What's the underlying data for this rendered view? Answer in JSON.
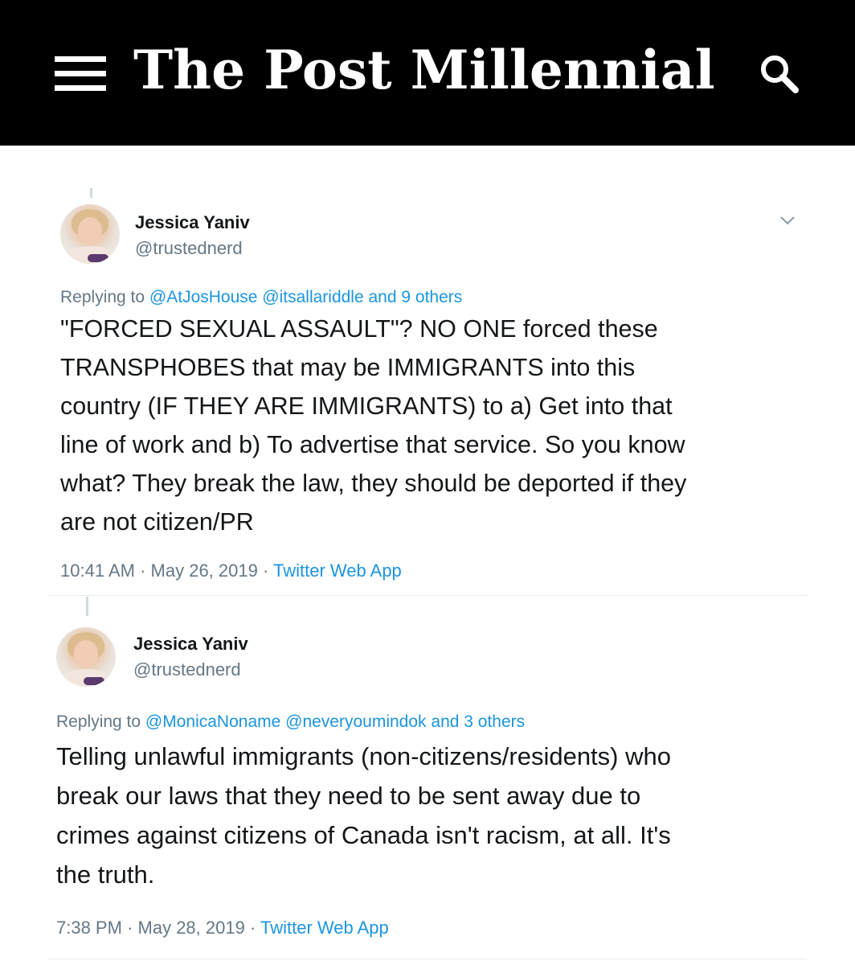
{
  "site": {
    "name": "The Post Millennial",
    "menu_icon": "hamburger-menu-icon",
    "search_icon": "search-icon",
    "header_bg": "#000000"
  },
  "colors": {
    "link": "#1b95e0",
    "muted": "#657786",
    "text": "#14171a"
  },
  "tweets": [
    {
      "author_name": "Jessica Yaniv",
      "handle": "@trustednerd",
      "replying_prefix": "Replying to",
      "replying_mentions": "@AtJosHouse @itsallariddle",
      "replying_and": "and",
      "replying_others": "9 others",
      "text_lines": [
        "\"FORCED SEXUAL ASSAULT\"? NO ONE forced these",
        "TRANSPHOBES that may be IMMIGRANTS into this",
        "country (IF THEY ARE IMMIGRANTS) to a) Get into that",
        "line of work and b) To advertise that service. So you know",
        "what? They break the law, they should be deported if they",
        "are not citizen/PR"
      ],
      "time": "10:41 AM",
      "date": "May 26, 2019",
      "source": "Twitter Web App"
    },
    {
      "author_name": "Jessica Yaniv",
      "handle": "@trustednerd",
      "replying_prefix": "Replying to",
      "replying_mentions": "@MonicaNoname @neveryoumindok",
      "replying_and": "and",
      "replying_others": "3 others",
      "text_lines": [
        "Telling unlawful immigrants (non-citizens/residents) who",
        "break our laws that they need to be sent away due to",
        "crimes against citizens of Canada isn't racism, at all. It's",
        "the truth."
      ],
      "time": "7:38 PM",
      "date": "May 28, 2019",
      "source": "Twitter Web App"
    }
  ],
  "meta_separator": "·"
}
